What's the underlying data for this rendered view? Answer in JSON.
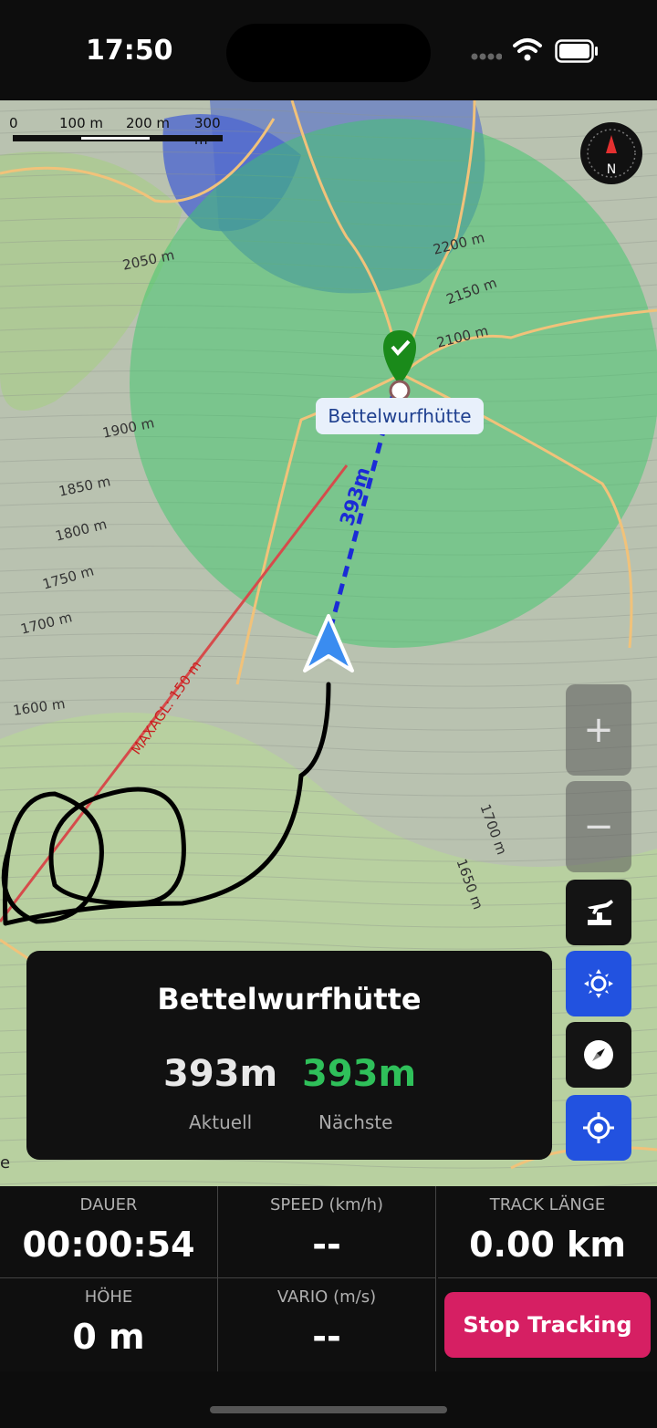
{
  "status_bar": {
    "time": "17:50"
  },
  "map": {
    "scale_labels": [
      "0",
      "100 m",
      "200 m",
      "300 m"
    ],
    "contour_labels": [
      "2050 m",
      "2200 m",
      "2150 m",
      "2100 m",
      "1900 m",
      "1850 m",
      "1800 m",
      "1750 m",
      "1700 m",
      "1600 m",
      "1700 m",
      "1650 m"
    ],
    "poi_name": "Bettelwurfhütte",
    "distance_label": "393m",
    "airspace_label": "MAXAGL: 150 m",
    "edge_label": "e",
    "colors": {
      "track": "#000000",
      "waypoint_pin": "#1a8a1a",
      "route_line": "#1b2bd6",
      "position_arrow": "#3a8cf0",
      "zone": "#3cc86a"
    },
    "icons": [
      "compass-icon",
      "zoom-in-icon",
      "zoom-out-icon",
      "runway-icon",
      "sun-locate-icon",
      "compass-needle-icon",
      "locate-icon"
    ],
    "zoom_in_label": "+",
    "zoom_out_label": "−"
  },
  "info_card": {
    "title": "Bettelwurfhütte",
    "current_value": "393m",
    "current_label": "Aktuell",
    "nearest_value": "393m",
    "nearest_label": "Nächste"
  },
  "stats": {
    "duration": {
      "label": "DAUER",
      "value": "00:00:54"
    },
    "speed": {
      "label": "SPEED (km/h)",
      "value": "--"
    },
    "track_length": {
      "label": "TRACK LÄNGE",
      "value": "0.00 km"
    },
    "altitude": {
      "label": "HÖHE",
      "value": "0 m"
    },
    "vario": {
      "label": "VARIO (m/s)",
      "value": "--"
    },
    "stop_button": "Stop Tracking"
  }
}
